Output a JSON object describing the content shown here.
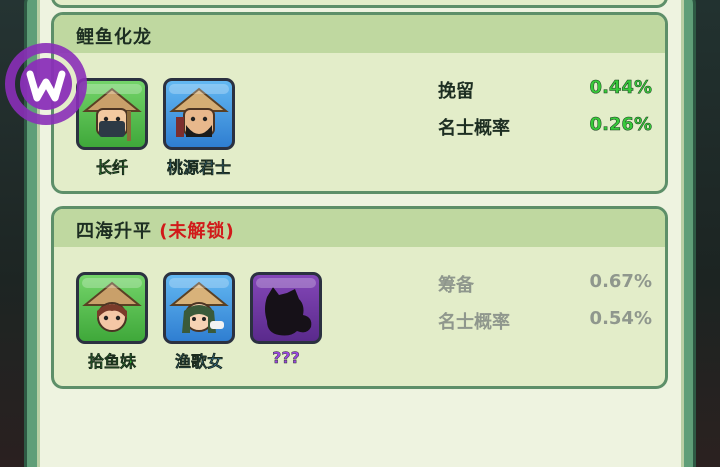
{
  "skins": [
    {
      "title": "鲤鱼化龙",
      "locked_tag": "",
      "heroes": [
        {
          "name": "长纤",
          "tile_color": "green",
          "icon": "straw-hat-boatman-icon"
        },
        {
          "name": "桃源君士",
          "tile_color": "blue",
          "icon": "straw-hat-scholar-icon"
        }
      ],
      "stats": [
        {
          "label": "挽留",
          "value": "0.44%"
        },
        {
          "label": "名士概率",
          "value": "0.26%"
        }
      ]
    },
    {
      "title": "四海升平",
      "locked_tag": "(未解锁)",
      "heroes": [
        {
          "name": "拾鱼妹",
          "tile_color": "green",
          "icon": "straw-hat-fishing-girl-icon"
        },
        {
          "name": "渔歌女",
          "tile_color": "blue",
          "icon": "straw-hat-singer-icon"
        },
        {
          "name": "???",
          "tile_color": "purple",
          "icon": "mystery-silhouette-icon"
        }
      ],
      "stats": [
        {
          "label": "筹备",
          "value": "0.67%"
        },
        {
          "label": "名士概率",
          "value": "0.54%"
        }
      ]
    }
  ],
  "overlay_logo": {
    "letter": "W",
    "icon": "w-watermark-logo",
    "color": "#8a2fb8"
  },
  "colors": {
    "frame_green": "#5f9e78",
    "card_bg": "#e3edc9",
    "header_bg": "#bfd8a0",
    "value_green": "#38c93a",
    "locked_red": "#d11a1a",
    "dim_gray": "#8f978d"
  }
}
